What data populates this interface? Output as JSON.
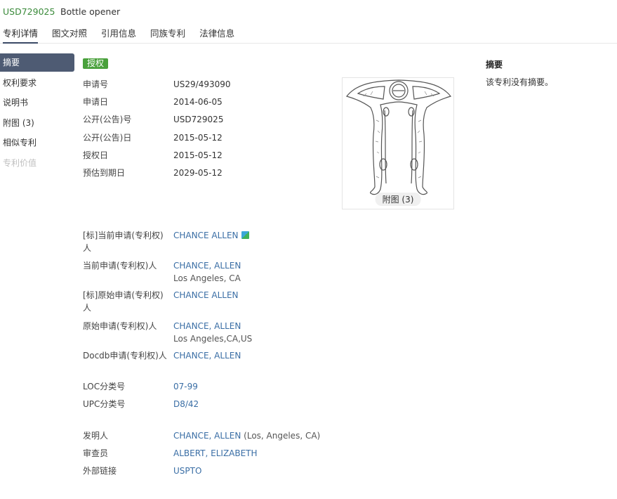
{
  "header": {
    "patent_id": "USD729025",
    "title": "Bottle opener",
    "tabs": [
      "专利详情",
      "图文对照",
      "引用信息",
      "同族专利",
      "法律信息"
    ]
  },
  "sidebar": {
    "items": [
      {
        "label": "摘要",
        "state": "active"
      },
      {
        "label": "权利要求",
        "state": "normal"
      },
      {
        "label": "说明书",
        "state": "normal"
      },
      {
        "label": "附图 (3)",
        "state": "normal"
      },
      {
        "label": "相似专利",
        "state": "normal"
      },
      {
        "label": "专利价值",
        "state": "disabled"
      }
    ]
  },
  "status_badge": "授权",
  "fields": {
    "app_no": {
      "label": "申请号",
      "value": "US29/493090"
    },
    "app_date": {
      "label": "申请日",
      "value": "2014-06-05"
    },
    "pub_no": {
      "label": "公开(公告)号",
      "value": "USD729025"
    },
    "pub_date": {
      "label": "公开(公告)日",
      "value": "2015-05-12"
    },
    "grant_date": {
      "label": "授权日",
      "value": "2015-05-12"
    },
    "expiry_date": {
      "label": "预估到期日",
      "value": "2029-05-12"
    },
    "std_current_assignee": {
      "label": "[标]当前申请(专利权)人",
      "value": "CHANCE ALLEN"
    },
    "current_assignee": {
      "label": "当前申请(专利权)人",
      "value": "CHANCE, ALLEN",
      "location": "Los Angeles, CA"
    },
    "std_original_assignee": {
      "label": "[标]原始申请(专利权)人",
      "value": "CHANCE ALLEN"
    },
    "original_assignee": {
      "label": "原始申请(专利权)人",
      "value": "CHANCE, ALLEN",
      "location": "Los Angeles,CA,US"
    },
    "docdb_assignee": {
      "label": "Docdb申请(专利权)人",
      "value": "CHANCE, ALLEN"
    },
    "loc_class": {
      "label": "LOC分类号",
      "value": "07-99"
    },
    "upc_class": {
      "label": "UPC分类号",
      "value": "D8/42"
    },
    "inventor": {
      "label": "发明人",
      "value": "CHANCE, ALLEN",
      "extra": "(Los, Angeles, CA)"
    },
    "examiner": {
      "label": "审查员",
      "value": "ALBERT, ELIZABETH"
    },
    "external_link": {
      "label": "外部链接",
      "value": "USPTO"
    }
  },
  "figure": {
    "label": "附图 (3)"
  },
  "abstract": {
    "title": "摘要",
    "text": "该专利没有摘要。"
  },
  "colors": {
    "badge": "#4aa13c",
    "link": "#3a6ea5",
    "patent_id": "#3a8a3a",
    "nav_active": "#4e5b73"
  }
}
